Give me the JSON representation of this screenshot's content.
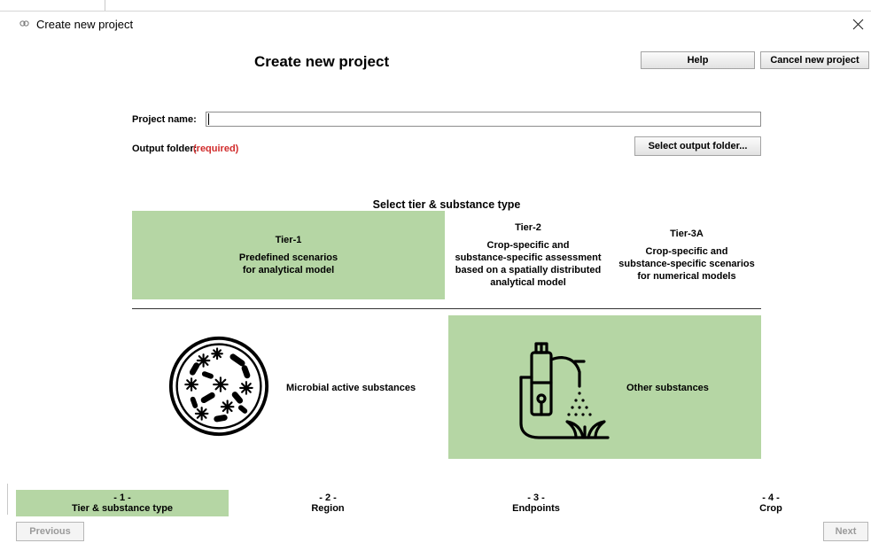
{
  "window": {
    "title": "Create new project",
    "icon": "app-icon",
    "close_icon": "close-icon"
  },
  "header": {
    "heading": "Create new project",
    "help_label": "Help",
    "cancel_label": "Cancel new project"
  },
  "form": {
    "project_name_label": "Project name:",
    "project_name_value": "",
    "output_folder_label": "Output folder:",
    "output_folder_required": "(required)",
    "select_folder_label": "Select output folder..."
  },
  "tiers": {
    "section_title": "Select tier & substance type",
    "items": [
      {
        "title": "Tier-1",
        "line1": "Predefined scenarios",
        "line2": "for analytical model",
        "line3": "",
        "line4": "",
        "selected": true
      },
      {
        "title": "Tier-2",
        "line1": "Crop-specific and",
        "line2": "substance-specific assessment",
        "line3": "based on a spatially distributed",
        "line4": "analytical model",
        "selected": false
      },
      {
        "title": "Tier-3A",
        "line1": "Crop-specific and",
        "line2": "substance-specific scenarios",
        "line3": "for numerical models",
        "line4": "",
        "selected": false
      }
    ]
  },
  "substances": {
    "microbial_label": "Microbial active substances",
    "microbial_icon": "microbe-icon",
    "other_label": "Other substances",
    "other_icon": "sprayer-icon",
    "selected": "Other substances"
  },
  "steps": [
    {
      "num": "- 1 -",
      "label": "Tier & substance type",
      "active": true
    },
    {
      "num": "- 2 -",
      "label": "Region",
      "active": false
    },
    {
      "num": "- 3 -",
      "label": "Endpoints",
      "active": false
    },
    {
      "num": "- 4 -",
      "label": "Crop",
      "active": false
    }
  ],
  "nav": {
    "previous_label": "Previous",
    "next_label": "Next"
  },
  "colors": {
    "selected_green": "#b5d6a4",
    "required_red": "#d12b2b",
    "disabled_text": "#9a9a9a"
  }
}
